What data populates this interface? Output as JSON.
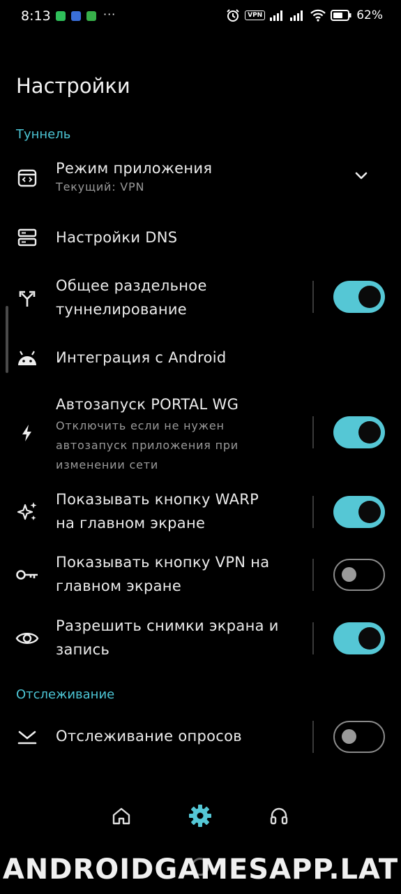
{
  "status_bar": {
    "time": "8:13",
    "dots": "···",
    "vpn": "VPN",
    "battery": "62%"
  },
  "page": {
    "title": "Настройки"
  },
  "sections": {
    "tunnel": "Туннель",
    "tracking": "Отслеживание"
  },
  "rows": {
    "app_mode": {
      "title": "Режим приложения",
      "subtitle": "Текущий: VPN",
      "icon": "code-window-icon"
    },
    "dns": {
      "title": "Настройки DNS",
      "icon": "dns-server-icon"
    },
    "split": {
      "title_line1": "Общее раздельное",
      "title_line2": "туннелирование",
      "icon": "split-arrows-icon",
      "enabled": true
    },
    "android": {
      "title": "Интеграция с Android",
      "icon": "android-icon"
    },
    "autostart": {
      "title": "Автозапуск PORTAL WG",
      "sub_line1": "Отключить если не нужен",
      "sub_line2": "автозапуск приложения при",
      "sub_line3": "изменении сети",
      "icon": "bolt-icon",
      "enabled": true
    },
    "warp": {
      "title_line1": "Показывать кнопку WARP",
      "title_line2": "на главном экране",
      "icon": "sparkles-icon",
      "enabled": true
    },
    "vpn_btn": {
      "title_line1": "Показывать кнопку VPN на",
      "title_line2": "главном экране",
      "icon": "key-icon",
      "enabled": false
    },
    "screenshots": {
      "title_line1": "Разрешить снимки экрана и",
      "title_line2": "запись",
      "icon": "eye-icon",
      "enabled": true
    },
    "polling": {
      "title": "Отслеживание опросов",
      "icon": "tracking-icon",
      "enabled": false
    }
  },
  "bottom_nav": [
    {
      "name": "home",
      "icon": "home-icon",
      "active": false
    },
    {
      "name": "settings",
      "icon": "gear-icon",
      "active": true
    },
    {
      "name": "support",
      "icon": "headset-icon",
      "active": false
    }
  ],
  "colors": {
    "accent": "#55c7d5",
    "section": "#4dc6d6",
    "background": "#000000"
  },
  "watermark": "ANDROIDGAMESAPP.LAT"
}
